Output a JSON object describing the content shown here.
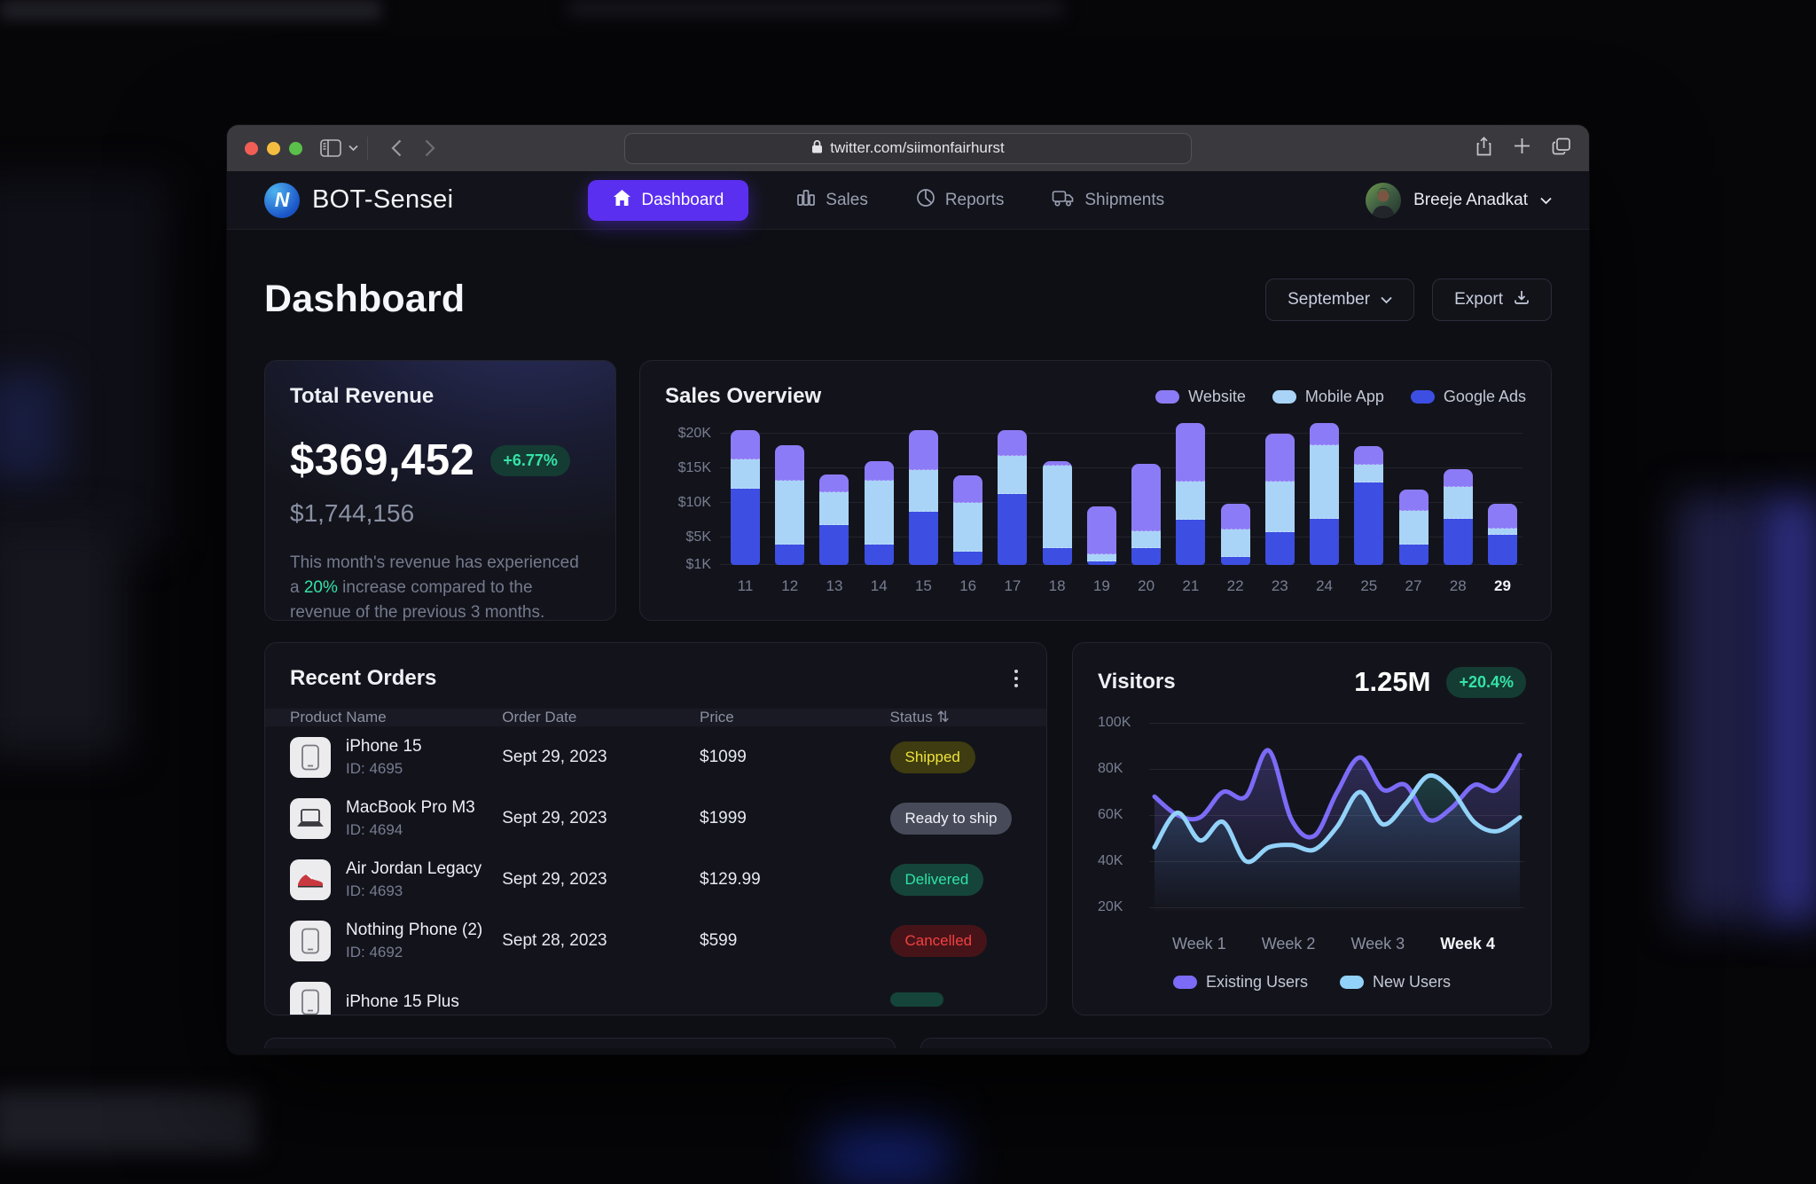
{
  "browser": {
    "url": "twitter.com/siimonfairhurst",
    "icons": [
      "sidebar-toggle-icon",
      "chevron-down-icon",
      "back-icon",
      "forward-icon",
      "lock-icon",
      "share-icon",
      "new-tab-icon",
      "tabs-icon"
    ]
  },
  "header": {
    "brand": "BOT-Sensei",
    "nav": [
      {
        "label": "Dashboard",
        "icon": "home-icon",
        "active": true
      },
      {
        "label": "Sales",
        "icon": "bar-chart-icon",
        "active": false
      },
      {
        "label": "Reports",
        "icon": "pie-chart-icon",
        "active": false
      },
      {
        "label": "Shipments",
        "icon": "truck-icon",
        "active": false
      }
    ],
    "user": {
      "name": "Breeje Anadkat",
      "icon": "avatar"
    }
  },
  "page": {
    "title": "Dashboard",
    "month_selector": "September",
    "export_label": "Export"
  },
  "revenue_card": {
    "title": "Total Revenue",
    "value": "$369,452",
    "delta": "+6.77%",
    "secondary": "$1,744,156",
    "desc_before": "This month's revenue has experienced a ",
    "desc_highlight": "20%",
    "desc_after": " increase compared to the revenue of the previous 3 months.",
    "accent_green": "#35e2a7"
  },
  "sales_overview": {
    "title": "Sales Overview",
    "legend": [
      {
        "label": "Website",
        "color": "#8c7bf6"
      },
      {
        "label": "Mobile App",
        "color": "#a9d4f8"
      },
      {
        "label": "Google Ads",
        "color": "#3d4ee2"
      }
    ],
    "chart_data": {
      "type": "bar",
      "stacked": true,
      "unit": "$K",
      "categories": [
        "11",
        "12",
        "13",
        "14",
        "15",
        "16",
        "17",
        "18",
        "19",
        "20",
        "21",
        "22",
        "23",
        "24",
        "25",
        "27",
        "28",
        "29"
      ],
      "highlight_category": "29",
      "series": [
        {
          "name": "Google Ads",
          "color": "#3d4ee2",
          "values": [
            12,
            3.9,
            6.8,
            3.9,
            8.7,
            2.9,
            11.3,
            3.5,
            1.5,
            3.4,
            7.5,
            2.2,
            5.8,
            7.7,
            12.9,
            4,
            7.7,
            5.3
          ]
        },
        {
          "name": "Mobile App",
          "color": "#a9d4f8",
          "values": [
            4.2,
            9.3,
            4.7,
            9.3,
            6,
            7.1,
            5.4,
            11.9,
            1,
            2.5,
            5.5,
            3.9,
            7.2,
            10.6,
            2.6,
            4.8,
            4.6,
            1
          ]
        },
        {
          "name": "Website",
          "color": "#8c7bf6",
          "values": [
            4.3,
            5.1,
            2.6,
            2.8,
            5.8,
            4,
            3.8,
            0.6,
            7,
            9.7,
            8.5,
            3.8,
            7,
            3.2,
            2.7,
            3.1,
            2.6,
            3.6
          ]
        }
      ],
      "ylim": [
        1,
        21.5
      ],
      "ticks": [
        {
          "value": 1,
          "label": "$1K"
        },
        {
          "value": 5,
          "label": "$5K"
        },
        {
          "value": 10,
          "label": "$10K"
        },
        {
          "value": 15,
          "label": "$15K"
        },
        {
          "value": 20,
          "label": "$20K"
        }
      ]
    }
  },
  "recent_orders": {
    "title": "Recent Orders",
    "columns": [
      "Product Name",
      "Order Date",
      "Price",
      "Status"
    ],
    "sort_icon": "⇅",
    "rows": [
      {
        "product": "iPhone 15",
        "id": "ID: 4695",
        "date": "Sept 29, 2023",
        "price": "$1099",
        "status": "Shipped",
        "style": "shipped",
        "thumb": "phone-icon"
      },
      {
        "product": "MacBook Pro M3",
        "id": "ID: 4694",
        "date": "Sept 29, 2023",
        "price": "$1999",
        "status": "Ready to ship",
        "style": "ready",
        "thumb": "laptop-icon"
      },
      {
        "product": "Air Jordan Legacy",
        "id": "ID: 4693",
        "date": "Sept 29, 2023",
        "price": "$129.99",
        "status": "Delivered",
        "style": "delivered",
        "thumb": "sneaker-icon"
      },
      {
        "product": "Nothing Phone (2)",
        "id": "ID: 4692",
        "date": "Sept 28, 2023",
        "price": "$599",
        "status": "Cancelled",
        "style": "cancelled",
        "thumb": "phone-icon"
      },
      {
        "product": "iPhone 15 Plus",
        "id": "",
        "date": "",
        "price": "",
        "status": "",
        "style": "delivered",
        "thumb": "phone-icon"
      }
    ],
    "status_colors": {
      "shipped": {
        "bg": "#3e3c10",
        "fg": "#efe23b"
      },
      "ready": {
        "bg": "#474b59",
        "fg": "#f0f2f8"
      },
      "delivered": {
        "bg": "#15443a",
        "fg": "#2fe3a6"
      },
      "cancelled": {
        "bg": "#461418",
        "fg": "#f34040"
      }
    }
  },
  "visitors": {
    "title": "Visitors",
    "value": "1.25M",
    "delta": "+20.4%",
    "chart_data": {
      "type": "line",
      "x_labels": [
        "Week 1",
        "Week 2",
        "Week 3",
        "Week 4"
      ],
      "highlight_label": "Week 4",
      "ylim": [
        20,
        100
      ],
      "unit": "K",
      "ticks": [
        {
          "value": 100,
          "label": "100K"
        },
        {
          "value": 80,
          "label": "80K"
        },
        {
          "value": 60,
          "label": "60K"
        },
        {
          "value": 40,
          "label": "40K"
        },
        {
          "value": 20,
          "label": "20K"
        }
      ],
      "series": [
        {
          "name": "Existing Users",
          "color": "#7b6bf7",
          "values": [
            68,
            60,
            59,
            70,
            68,
            88,
            58,
            51,
            70,
            85,
            71,
            73,
            58,
            63,
            73,
            71,
            86
          ]
        },
        {
          "name": "New Users",
          "color": "#92d2f9",
          "values": [
            46,
            61,
            49,
            57,
            40,
            46,
            47,
            45,
            55,
            70,
            56,
            65,
            77,
            71,
            57,
            53,
            59
          ]
        }
      ]
    }
  }
}
